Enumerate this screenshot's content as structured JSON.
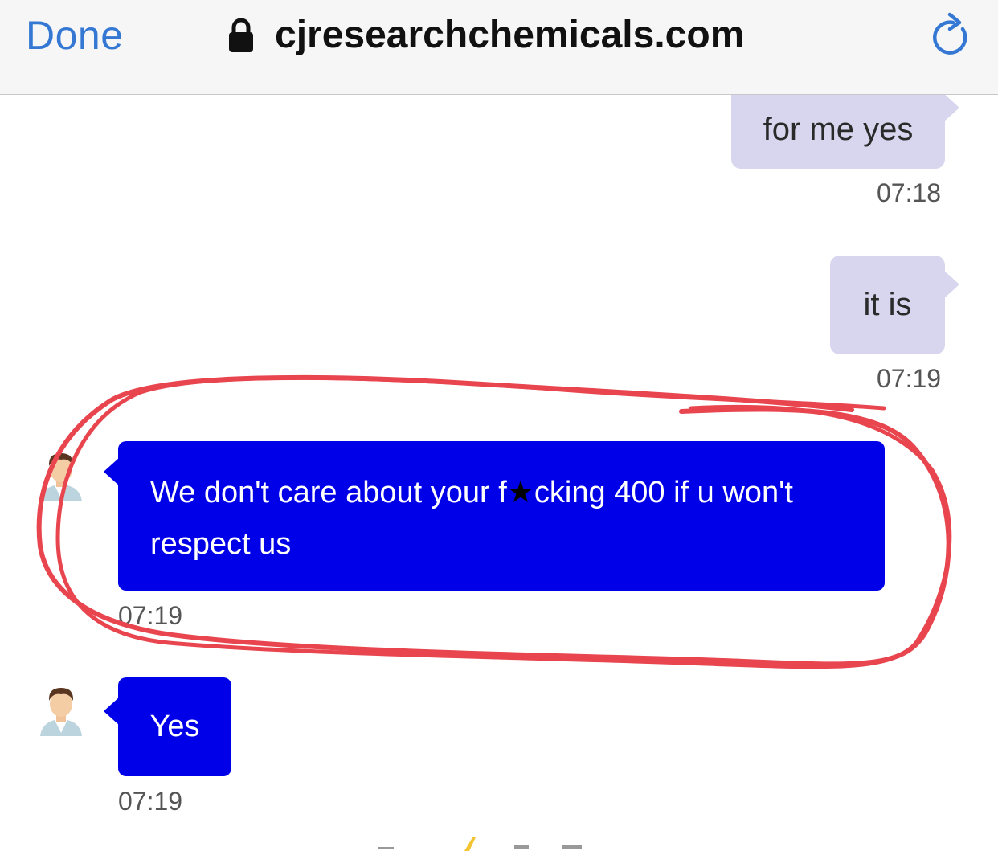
{
  "toolbar": {
    "done_label": "Done",
    "url": "cjresearchchemicals.com",
    "lock_icon": "lock-icon",
    "reload_icon": "reload-icon",
    "accent_color": "#3478d4"
  },
  "messages": [
    {
      "side": "outgoing",
      "text": "for me yes",
      "time": "07:18"
    },
    {
      "side": "outgoing",
      "text": "it is",
      "time": "07:19"
    },
    {
      "side": "incoming",
      "text_line1": "We don't care about your f",
      "text_star": "★",
      "text_line1b": "cking 400 if u won't",
      "text_line2": "respect us",
      "time": "07:19"
    },
    {
      "side": "incoming",
      "text": "Yes",
      "time": "07:19"
    }
  ],
  "colors": {
    "incoming_bubble": "#0000e8",
    "outgoing_bubble": "#d8d6ee",
    "annotation": "#e8454f"
  }
}
